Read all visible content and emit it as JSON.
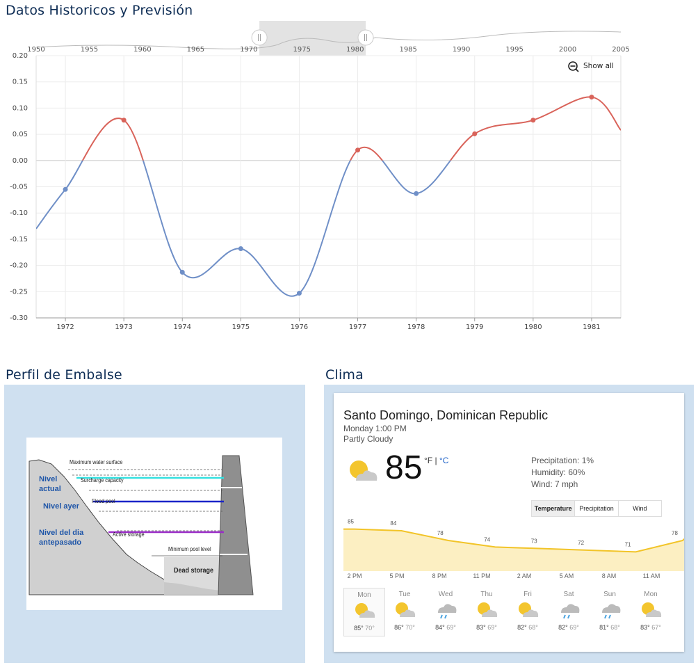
{
  "titles": {
    "historic": "Datos Historicos y Previsión",
    "reservoir": "Perfil de Embalse",
    "weather": "Clima"
  },
  "chart_data": {
    "type": "line",
    "x": [
      1971.5,
      1972,
      1973,
      1974,
      1975,
      1976,
      1977,
      1978,
      1979,
      1980,
      1981,
      1981.5
    ],
    "y": [
      -0.13,
      -0.055,
      0.077,
      -0.213,
      -0.168,
      -0.253,
      0.02,
      -0.063,
      0.051,
      0.077,
      0.121,
      0.058
    ],
    "xlim": [
      1971.5,
      1981.5
    ],
    "ylim": [
      -0.3,
      0.2
    ],
    "xticks": [
      "1972",
      "1973",
      "1974",
      "1975",
      "1976",
      "1977",
      "1978",
      "1979",
      "1980",
      "1981"
    ],
    "yticks": [
      "0.20",
      "0.15",
      "0.10",
      "0.05",
      "0.00",
      "-0.05",
      "-0.10",
      "-0.15",
      "-0.20",
      "-0.25",
      "-0.30"
    ],
    "positive_color": "#d9635a",
    "negative_color": "#6f8fc7",
    "grid": true,
    "navigator": {
      "ticks": [
        "1950",
        "1955",
        "1960",
        "1965",
        "1970",
        "1975",
        "1980",
        "1985",
        "1990",
        "1995",
        "2000",
        "2005"
      ],
      "range": [
        1950,
        2005
      ],
      "selected": [
        1971,
        1981
      ]
    },
    "show_all_label": "Show all"
  },
  "reservoir": {
    "labels": {
      "max_surface": "Maximum water surface",
      "surcharge": "Surcharge capacity",
      "flood_pool": "Flood pool",
      "active_storage": "Active storage",
      "min_pool": "Minimum pool level",
      "dead_storage": "Dead storage"
    },
    "levels": {
      "actual": "Nivel actual",
      "ayer": "Nivel ayer",
      "antepasado": "Nivel del dia antepasado"
    },
    "colors": {
      "actual": "#33e0e0",
      "ayer": "#1a24c8",
      "antepasado": "#9a2cc8"
    }
  },
  "weather": {
    "location": "Santo Domingo, Dominican Republic",
    "datetime": "Monday 1:00 PM",
    "condition": "Partly Cloudy",
    "temp": "85",
    "unit_f": "°F",
    "unit_sep": " | ",
    "unit_c": "°C",
    "precipitation": "Precipitation: 1%",
    "humidity": "Humidity: 60%",
    "wind": "Wind: 7 mph",
    "tabs": [
      "Temperature",
      "Precipitation",
      "Wind"
    ],
    "hourly_temps": [
      85,
      84,
      78,
      74,
      73,
      72,
      71,
      78
    ],
    "hourly_labels": [
      "2 PM",
      "5 PM",
      "8 PM",
      "11 PM",
      "2 AM",
      "5 AM",
      "8 AM",
      "11 AM"
    ],
    "days": [
      {
        "name": "Mon",
        "hi": "85°",
        "lo": "70°",
        "icon": "partly-cloudy-icon"
      },
      {
        "name": "Tue",
        "hi": "86°",
        "lo": "70°",
        "icon": "partly-cloudy-icon"
      },
      {
        "name": "Wed",
        "hi": "84°",
        "lo": "69°",
        "icon": "rain-icon"
      },
      {
        "name": "Thu",
        "hi": "83°",
        "lo": "69°",
        "icon": "partly-cloudy-icon"
      },
      {
        "name": "Fri",
        "hi": "82°",
        "lo": "68°",
        "icon": "partly-cloudy-icon"
      },
      {
        "name": "Sat",
        "hi": "82°",
        "lo": "69°",
        "icon": "rain-icon"
      },
      {
        "name": "Sun",
        "hi": "81°",
        "lo": "68°",
        "icon": "rain-icon"
      },
      {
        "name": "Mon",
        "hi": "83°",
        "lo": "67°",
        "icon": "partly-cloudy-icon"
      }
    ]
  }
}
